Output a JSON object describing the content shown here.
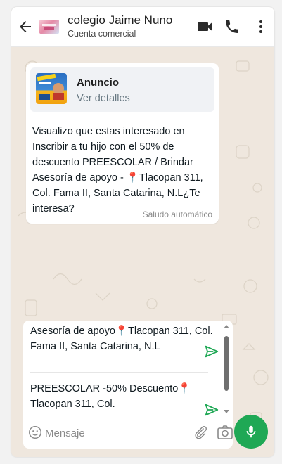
{
  "header": {
    "contact_name": "colegio Jaime Nuno",
    "contact_subtitle": "Cuenta comercial",
    "icons": [
      "back-arrow-icon",
      "video-call-icon",
      "phone-icon",
      "more-vert-icon"
    ]
  },
  "message": {
    "ad_title": "Anuncio",
    "ad_link": "Ver detalles",
    "text_part1": "Visualizo que estas interesado en Inscribir a tu hijo con el 50% de descuento PREESCOLAR / Brindar Asesoría de apoyo - ",
    "text_part2": "Tlacopan 311, Col. Fama II, Santa Catarina, N.L¿Te interesa?",
    "footer": "Saludo automático"
  },
  "quick_replies": [
    {
      "part1": "Asesoría de apoyo",
      "part2": "Tlacopan 311, Col. Fama II, Santa Catarina, N.L"
    },
    {
      "part1": "PREESCOLAR -50% Descuento",
      "part2": "Tlacopan 311, Col."
    }
  ],
  "input": {
    "placeholder": "Mensaje"
  },
  "colors": {
    "accent_green": "#1fa855",
    "chat_background": "#efe7de",
    "bubble": "#ffffff"
  }
}
